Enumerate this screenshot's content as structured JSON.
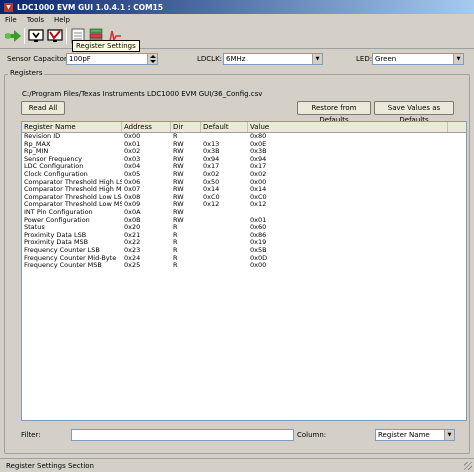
{
  "window": {
    "title": "LDC1000 EVM GUI 1.0.4.1 : COM15"
  },
  "menu": [
    "File",
    "Tools",
    "Help"
  ],
  "toolbar": {
    "tooltip": "Register Settings",
    "icons": [
      "green-arrow-icon",
      "monitor-download-icon",
      "monitor-check-icon",
      "register-settings-icon",
      "stack-icon",
      "graph-icon"
    ]
  },
  "settings": {
    "sensor_cap_label": "Sensor Capacitor:",
    "sensor_cap_value": "100pF",
    "ldclk_label": "LDCLK:",
    "ldclk_value": "6MHz",
    "led_label": "LED:",
    "led_value": "Green"
  },
  "registers": {
    "group_title": "Registers",
    "config_path": "C:/Program Files/Texas Instruments LDC1000 EVM GUI/36_Config.csv",
    "read_all_label": "Read All",
    "restore_label": "Restore from Defaults",
    "save_label": "Save Values as Defaults",
    "columns": [
      "Register Name",
      "Address",
      "Dir",
      "Default",
      "Value"
    ],
    "rows": [
      [
        "Revision ID",
        "0x00",
        "R",
        "",
        "0x80"
      ],
      [
        "Rp_MAX",
        "0x01",
        "RW",
        "0x13",
        "0x0E"
      ],
      [
        "Rp_MIN",
        "0x02",
        "RW",
        "0x3B",
        "0x3B"
      ],
      [
        "Sensor Frequency",
        "0x03",
        "RW",
        "0x94",
        "0x94"
      ],
      [
        "LDC Configuration",
        "0x04",
        "RW",
        "0x17",
        "0x17"
      ],
      [
        "Clock Configuration",
        "0x05",
        "RW",
        "0x02",
        "0x02"
      ],
      [
        "Comparator Threshold High LSB",
        "0x06",
        "RW",
        "0x50",
        "0x00"
      ],
      [
        "Comparator Threshold High MSB",
        "0x07",
        "RW",
        "0x14",
        "0x14"
      ],
      [
        "Comparator Threshold Low LSB",
        "0x08",
        "RW",
        "0xC0",
        "0xC0"
      ],
      [
        "Comparator Threshold Low MSB",
        "0x09",
        "RW",
        "0x12",
        "0x12"
      ],
      [
        "INT Pin Configuration",
        "0x0A",
        "RW",
        "",
        ""
      ],
      [
        "Power Configuration",
        "0x0B",
        "RW",
        "",
        "0x01"
      ],
      [
        "Status",
        "0x20",
        "R",
        "",
        "0x60"
      ],
      [
        "Proximity Data LSB",
        "0x21",
        "R",
        "",
        "0x86"
      ],
      [
        "Proximity Data MSB",
        "0x22",
        "R",
        "",
        "0x19"
      ],
      [
        "Frequency Counter LSB",
        "0x23",
        "R",
        "",
        "0x5B"
      ],
      [
        "Frequency Counter Mid-Byte",
        "0x24",
        "R",
        "",
        "0x0D"
      ],
      [
        "Frequency Counter MSB",
        "0x25",
        "R",
        "",
        "0x00"
      ]
    ]
  },
  "filter": {
    "filter_label": "Filter:",
    "filter_value": "",
    "column_label": "Column:",
    "column_value": "Register Name"
  },
  "status": {
    "text": "Register Settings Section"
  }
}
